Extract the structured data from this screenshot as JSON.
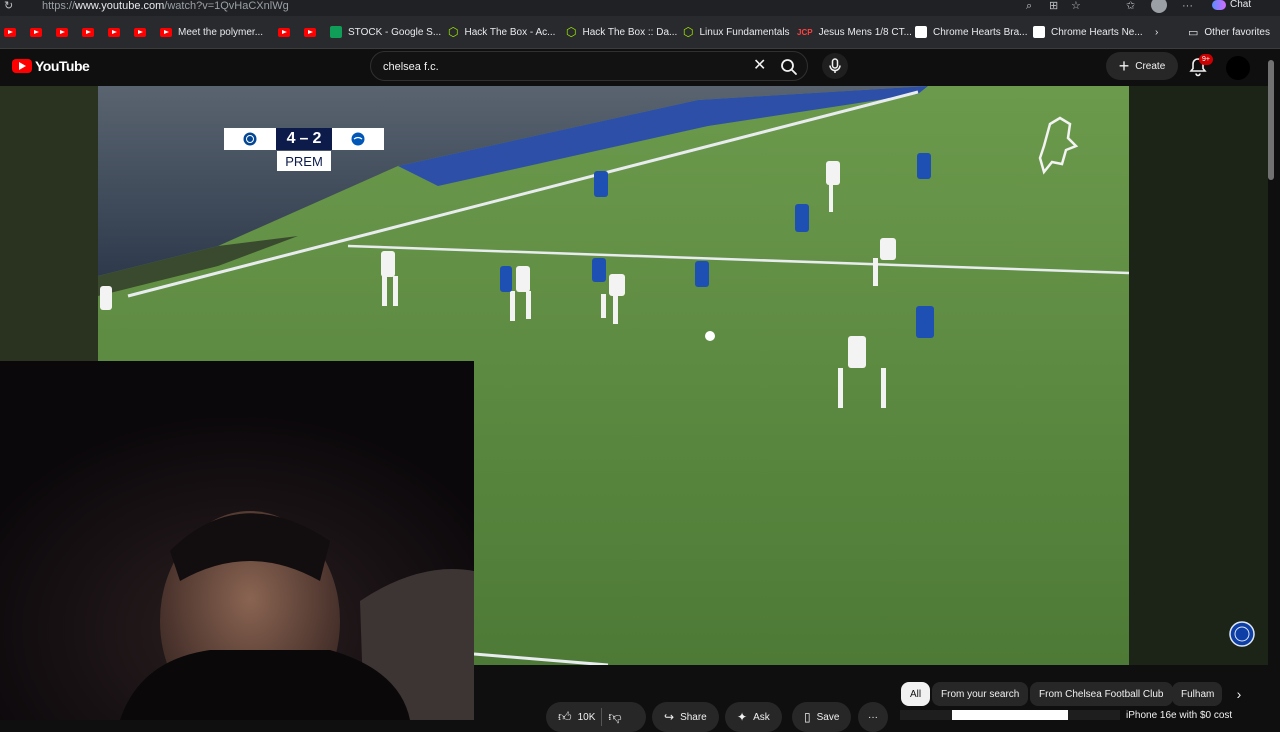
{
  "browser": {
    "url_prefix": "https://",
    "url_domain": "www.youtube.com",
    "url_path": "/watch?v=1QvHaCXnlWg",
    "chat_label": "Chat"
  },
  "bookmarks": {
    "items": [
      {
        "label": "Meet the polymer..."
      },
      {
        "label": "STOCK - Google S..."
      },
      {
        "label": "Hack The Box - Ac..."
      },
      {
        "label": "Hack The Box :: Da..."
      },
      {
        "label": "Linux Fundamentals"
      },
      {
        "label": "Jesus Mens 1/8 CT..."
      },
      {
        "label": "Chrome Hearts Bra..."
      },
      {
        "label": "Chrome Hearts Ne..."
      }
    ],
    "other_favorites": "Other favorites"
  },
  "youtube": {
    "logo_text": "YouTube",
    "search_value": "chelsea f.c.",
    "create_label": "Create",
    "notification_badge": "9+"
  },
  "video": {
    "score": {
      "home": "4",
      "sep": "–",
      "away": "2",
      "competition": "PREM"
    }
  },
  "actions": {
    "likes": "10K",
    "share": "Share",
    "ask": "Ask",
    "save": "Save",
    "more": "···"
  },
  "chips": [
    {
      "label": "All",
      "active": true
    },
    {
      "label": "From your search"
    },
    {
      "label": "From Chelsea Football Club"
    },
    {
      "label": "Fulham"
    }
  ],
  "promo": {
    "text": "iPhone 16e with $0 cost"
  },
  "colors": {
    "yt_red": "#ff0000",
    "chelsea_blue": "#034694",
    "pitch_green": "#4e7a3c"
  }
}
